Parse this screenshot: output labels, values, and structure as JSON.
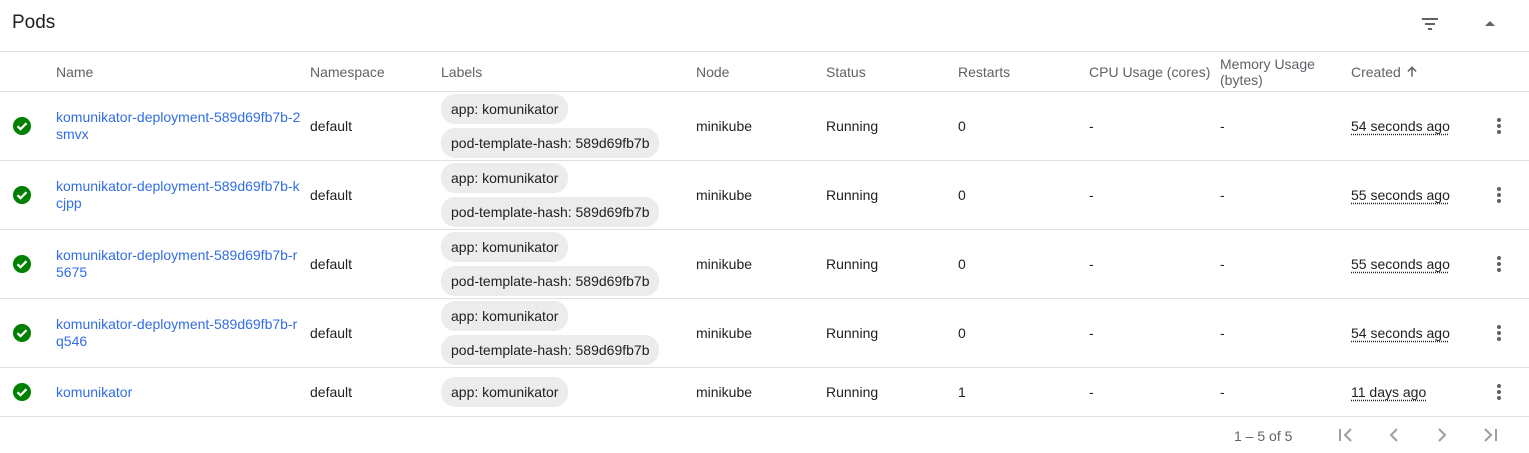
{
  "header": {
    "title": "Pods",
    "filter_icon": "filter-list-icon",
    "collapse_icon": "arrow-drop-up-icon"
  },
  "columns": {
    "name": "Name",
    "namespace": "Namespace",
    "labels": "Labels",
    "node": "Node",
    "status": "Status",
    "restarts": "Restarts",
    "cpu": "CPU Usage (cores)",
    "memory": "Memory Usage (bytes)",
    "created": "Created"
  },
  "rows": [
    {
      "name": "komunikator-deployment-589d69fb7b-2smvx",
      "namespace": "default",
      "labels": [
        "app: komunikator",
        "pod-template-hash: 589d69fb7b"
      ],
      "node": "minikube",
      "status": "Running",
      "restarts": "0",
      "cpu": "-",
      "memory": "-",
      "created": "54 seconds ago"
    },
    {
      "name": "komunikator-deployment-589d69fb7b-kcjpp",
      "namespace": "default",
      "labels": [
        "app: komunikator",
        "pod-template-hash: 589d69fb7b"
      ],
      "node": "minikube",
      "status": "Running",
      "restarts": "0",
      "cpu": "-",
      "memory": "-",
      "created": "55 seconds ago"
    },
    {
      "name": "komunikator-deployment-589d69fb7b-r5675",
      "namespace": "default",
      "labels": [
        "app: komunikator",
        "pod-template-hash: 589d69fb7b"
      ],
      "node": "minikube",
      "status": "Running",
      "restarts": "0",
      "cpu": "-",
      "memory": "-",
      "created": "55 seconds ago"
    },
    {
      "name": "komunikator-deployment-589d69fb7b-rq546",
      "namespace": "default",
      "labels": [
        "app: komunikator",
        "pod-template-hash: 589d69fb7b"
      ],
      "node": "minikube",
      "status": "Running",
      "restarts": "0",
      "cpu": "-",
      "memory": "-",
      "created": "54 seconds ago"
    },
    {
      "name": "komunikator",
      "namespace": "default",
      "labels": [
        "app: komunikator"
      ],
      "node": "minikube",
      "status": "Running",
      "restarts": "1",
      "cpu": "-",
      "memory": "-",
      "created": "11 days ago"
    }
  ],
  "pagination": {
    "range": "1 – 5 of 5"
  },
  "colors": {
    "link": "#326de6",
    "success": "#008000",
    "muted": "#5f6368",
    "chip": "#ececec",
    "border": "#e0e0e0"
  }
}
